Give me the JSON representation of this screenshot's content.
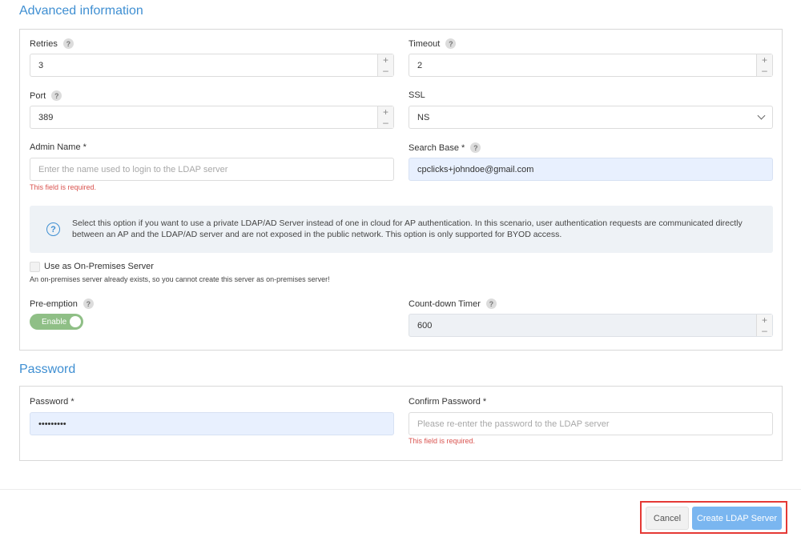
{
  "advanced": {
    "title": "Advanced information",
    "retries": {
      "label": "Retries",
      "value": "3"
    },
    "timeout": {
      "label": "Timeout",
      "value": "2"
    },
    "port": {
      "label": "Port",
      "value": "389"
    },
    "ssl": {
      "label": "SSL",
      "value": "NS"
    },
    "admin_name": {
      "label": "Admin Name *",
      "placeholder": "Enter the name used to login to the LDAP server",
      "error": "This field is required."
    },
    "search_base": {
      "label": "Search Base *",
      "value": "cpclicks+johndoe@gmail.com"
    },
    "info_text": "Select this option if you want to use a private LDAP/AD Server instead of one in cloud for AP authentication. In this scenario, user authentication requests are communicated directly between an AP and the LDAP/AD server and are not exposed in the public network. This option is only supported for BYOD access.",
    "on_premises": {
      "label": "Use as On-Premises Server",
      "note": "An on-premises server already exists, so you cannot create this server as on-premises server!"
    },
    "preemption": {
      "label": "Pre-emption",
      "toggle": "Enable"
    },
    "countdown": {
      "label": "Count-down Timer",
      "value": "600"
    }
  },
  "password": {
    "title": "Password",
    "password": {
      "label": "Password *",
      "value": "•••••••••"
    },
    "confirm": {
      "label": "Confirm Password *",
      "placeholder": "Please re-enter the password to the LDAP server",
      "error": "This field is required."
    }
  },
  "footer": {
    "cancel": "Cancel",
    "create": "Create LDAP Server"
  },
  "icons": {
    "help": "?",
    "plus": "+",
    "minus": "–",
    "info": "?"
  },
  "colors": {
    "accent": "#3f8fd2",
    "error": "#d9534f",
    "toggle": "#8fbf86",
    "primary_button": "#7ab6f0",
    "highlight_border": "#e53935"
  }
}
